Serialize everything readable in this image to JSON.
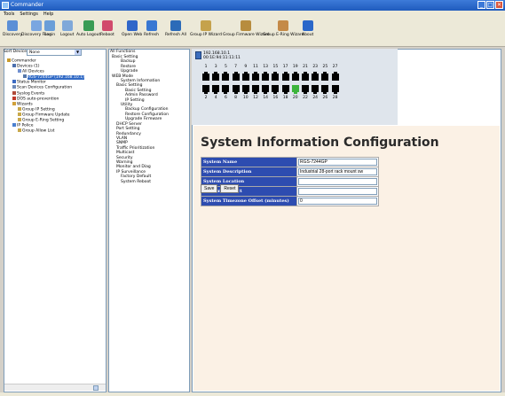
{
  "window": {
    "title": "Commander",
    "min": "_",
    "max": "□",
    "close": "✕"
  },
  "menu": [
    "Tools",
    "Settings",
    "Help"
  ],
  "toolbar": [
    {
      "label": "Discovery",
      "color": "#5b8fd6"
    },
    {
      "label": "Discovery Files",
      "color": "#7aa6e0"
    },
    {
      "label": "Login",
      "color": "#6a9ed8"
    },
    {
      "label": "Logout",
      "color": "#7fa8d9"
    },
    {
      "label": "Auto Logout",
      "color": "#3a9c55"
    },
    {
      "label": "Reboot",
      "color": "#d14a6c"
    },
    {
      "label": "Open Web",
      "color": "#2f66c9"
    },
    {
      "label": "Refresh",
      "color": "#3877d2"
    },
    {
      "label": "Refresh All",
      "color": "#2c6bb8"
    },
    {
      "label": "Group IP Wizard",
      "color": "#c5a24c"
    },
    {
      "label": "Group Firmware Wizard",
      "color": "#b78c3e"
    },
    {
      "label": "Group E-Ring Wizard",
      "color": "#c48a48"
    },
    {
      "label": "About",
      "color": "#2a67c9"
    }
  ],
  "left": {
    "sort_label": "Sort Devices By:",
    "sort_value": "None",
    "tree": [
      {
        "text": "Commander",
        "indent": 0
      },
      {
        "text": "Devices (1)",
        "indent": 1
      },
      {
        "text": "All Devices",
        "indent": 2
      },
      {
        "text": "RGS-7244GP (192.168.10.1)",
        "indent": 3,
        "selected": true
      },
      {
        "text": "Status Monitor",
        "indent": 1
      },
      {
        "text": "Scan Devices Configuration",
        "indent": 1
      },
      {
        "text": "Syslog Events",
        "indent": 1
      },
      {
        "text": "DOS auto-prevention",
        "indent": 1
      },
      {
        "text": "Wizards",
        "indent": 1
      },
      {
        "text": "Group IP Setting",
        "indent": 2
      },
      {
        "text": "Group Firmware Update",
        "indent": 2
      },
      {
        "text": "Group E-Ring Setting",
        "indent": 2
      },
      {
        "text": "IP Police",
        "indent": 1
      },
      {
        "text": "Group Allow List",
        "indent": 2
      }
    ]
  },
  "middle": {
    "heading": "All Functions",
    "tree": [
      {
        "text": "Basic Setting",
        "indent": 0
      },
      {
        "text": "Backup",
        "indent": 2
      },
      {
        "text": "Restore",
        "indent": 2
      },
      {
        "text": "Upgrade",
        "indent": 2
      },
      {
        "text": "WEB Mode",
        "indent": 0
      },
      {
        "text": "System Information",
        "indent": 2
      },
      {
        "text": "Basic Setting",
        "indent": 1
      },
      {
        "text": "Basic Setting",
        "indent": 3
      },
      {
        "text": "Admin Password",
        "indent": 3
      },
      {
        "text": "IP Setting",
        "indent": 3
      },
      {
        "text": "Utility",
        "indent": 2
      },
      {
        "text": "Backup Configuration",
        "indent": 3
      },
      {
        "text": "Restore Configuration",
        "indent": 3
      },
      {
        "text": "Upgrade Firmware",
        "indent": 3
      },
      {
        "text": "DHCP Server",
        "indent": 1
      },
      {
        "text": "Port Setting",
        "indent": 1
      },
      {
        "text": "Redundancy",
        "indent": 1
      },
      {
        "text": "VLAN",
        "indent": 1
      },
      {
        "text": "SNMP",
        "indent": 1
      },
      {
        "text": "Traffic Prioritization",
        "indent": 1
      },
      {
        "text": "Multicast",
        "indent": 1
      },
      {
        "text": "Security",
        "indent": 1
      },
      {
        "text": "Warning",
        "indent": 1
      },
      {
        "text": "Monitor and Diag",
        "indent": 1
      },
      {
        "text": "IP Surveillance",
        "indent": 1
      },
      {
        "text": "Factory Default",
        "indent": 2
      },
      {
        "text": "System Reboot",
        "indent": 2
      }
    ]
  },
  "device": {
    "ip": "192.168.10.1",
    "mac": "00:1E:94:11:11:11",
    "top_ports": [
      "1",
      "3",
      "5",
      "7",
      "9",
      "11",
      "13",
      "15",
      "17",
      "19",
      "21",
      "23",
      "25",
      "27"
    ],
    "bottom_ports": [
      "2",
      "4",
      "6",
      "8",
      "10",
      "12",
      "14",
      "16",
      "18",
      "20",
      "22",
      "24",
      "26",
      "28"
    ],
    "active_port": "20"
  },
  "config": {
    "title": "System Information Configuration",
    "rows": [
      {
        "label": "System Name",
        "value": "RGS-7244GP"
      },
      {
        "label": "System Description",
        "value": "Industrial 28-port rack mount sw"
      },
      {
        "label": "System Location",
        "value": ""
      },
      {
        "label": "System Contact",
        "value": ""
      },
      {
        "label": "System Timezone Offset (minutes)",
        "value": "0"
      }
    ],
    "save_label": "Save",
    "reset_label": "Reset"
  }
}
